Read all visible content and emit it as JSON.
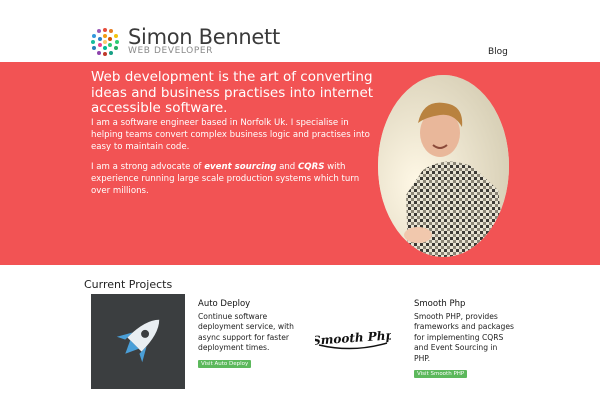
{
  "header": {
    "name": "Simon Bennett",
    "subtitle": "WEB DEVELOPER",
    "nav": {
      "blog": "Blog"
    }
  },
  "hero": {
    "title": "Web development is the art of converting ideas and business practises into internet accessible software.",
    "p1": "I am a software engineer based in Norfolk Uk. I specialise in helping teams convert complex business logic and practises into easy to maintain code.",
    "p2_prefix": "I am a strong advocate of ",
    "p2_em1": "event sourcing",
    "p2_mid": " and ",
    "p2_em2": "CQRS",
    "p2_suffix": " with experience running large scale production systems which turn over millions.",
    "accent_color": "#f25354"
  },
  "projects": {
    "title": "Current Projects",
    "items": [
      {
        "name": "Auto Deploy",
        "description": "Continue software deployment service, with async support for faster deployment times.",
        "button": "Visit Auto Deploy",
        "icon": "rocket-icon"
      },
      {
        "name": "Smooth Php",
        "logo_text": "Smooth Php",
        "description": "Smooth PHP, provides frameworks and packages for implementing CQRS and Event Sourcing in PHP.",
        "button": "Visit Smooth PHP"
      }
    ],
    "button_color": "#5cb85c"
  }
}
